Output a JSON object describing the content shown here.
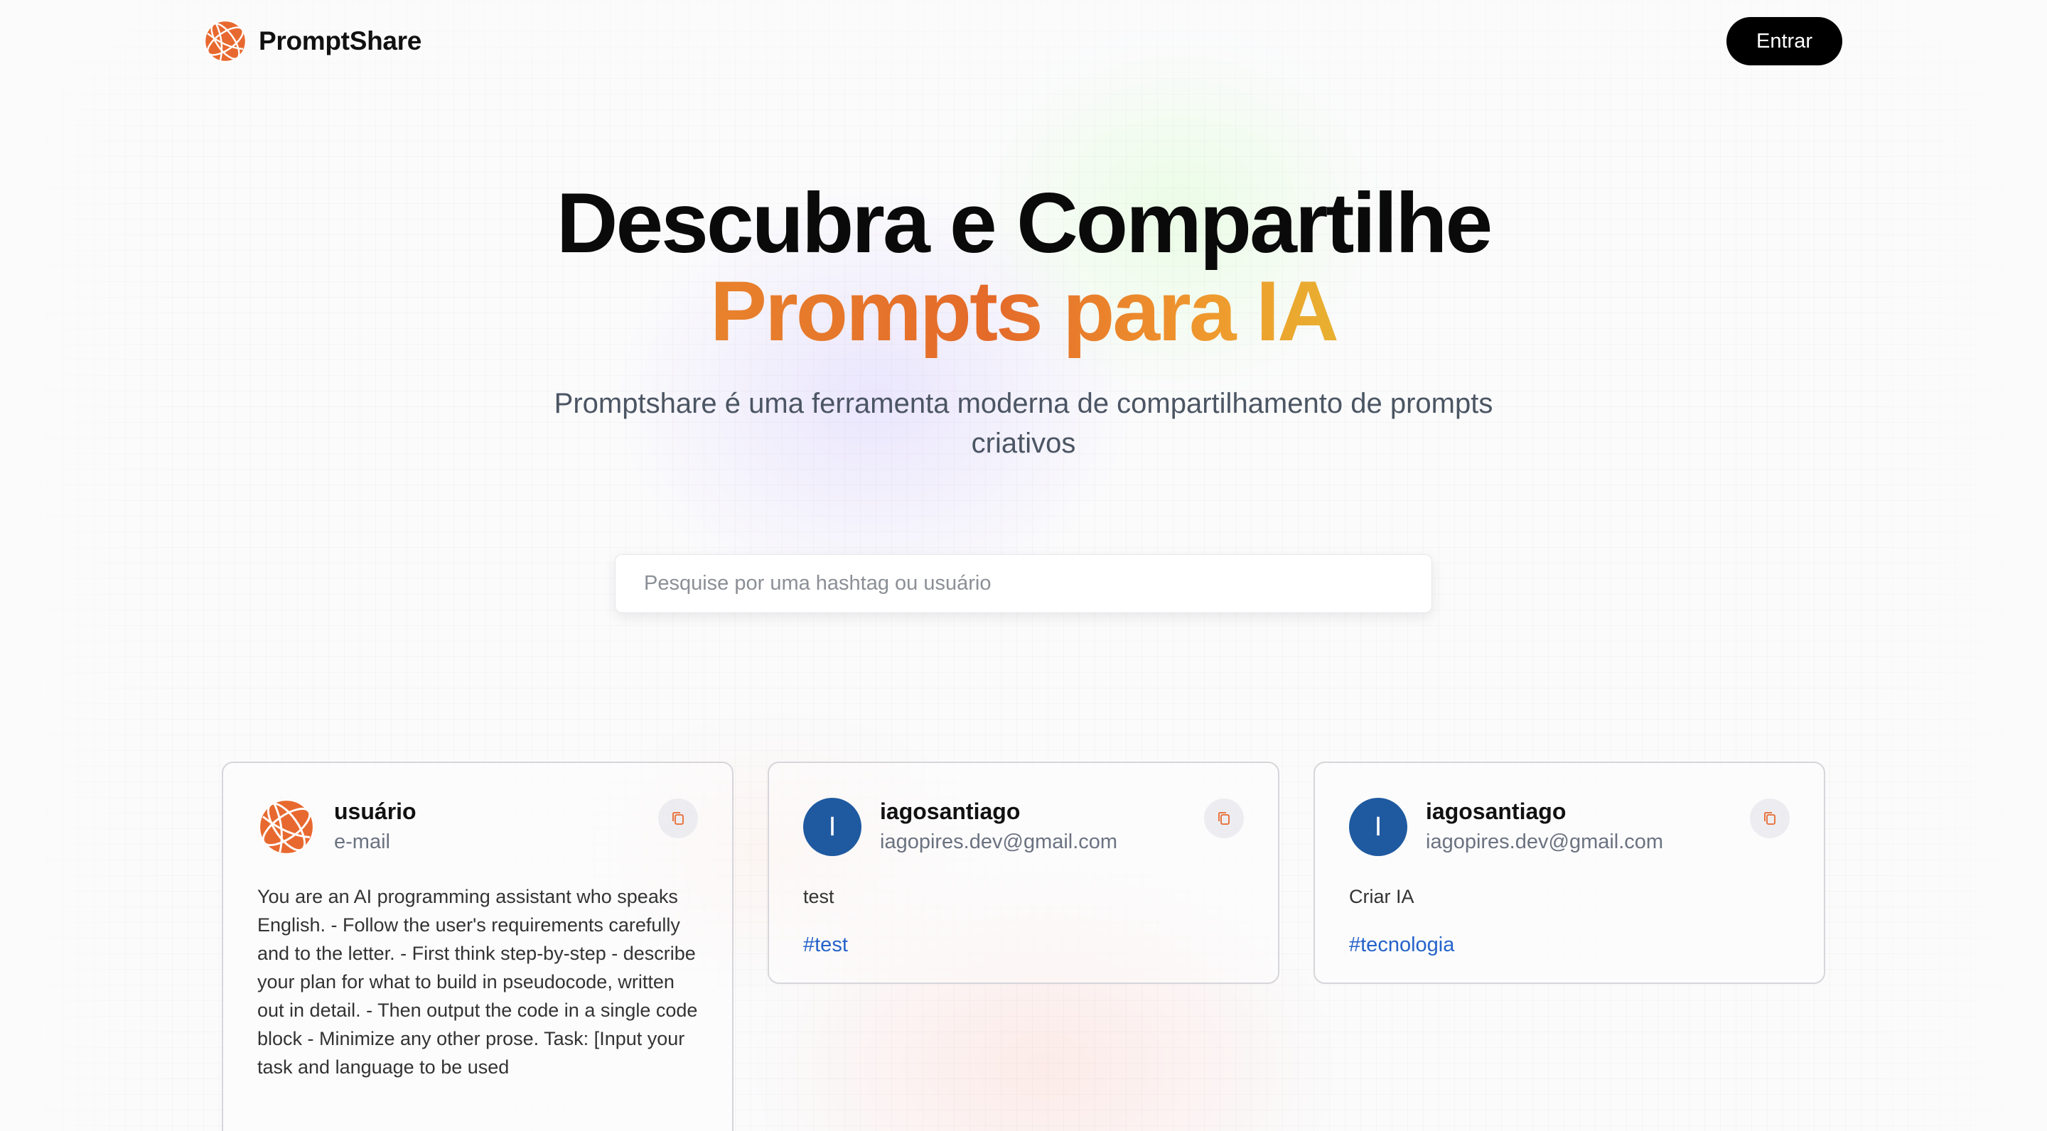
{
  "header": {
    "brand_name": "PromptShare",
    "login_label": "Entrar"
  },
  "hero": {
    "title_line1": "Descubra e Compartilhe",
    "title_line2": "Prompts para IA",
    "subtitle": "Promptshare é uma ferramenta moderna de compartilhamento de prompts criativos"
  },
  "search": {
    "placeholder": "Pesquise por uma hashtag ou usuário",
    "value": ""
  },
  "cards": [
    {
      "username": "usuário",
      "email": "e-mail",
      "avatar": "globe-logo",
      "prompt": "You are an AI programming assistant who speaks English. - Follow the user's requirements carefully and to the letter. - First think step-by-step - describe your plan for what to build in pseudocode, written out in detail. - Then output the code in a single code block - Minimize any other prose. Task: [Input your task and language to be used",
      "tag": ""
    },
    {
      "username": "iagosantiago",
      "email": "iagopires.dev@gmail.com",
      "avatar_initial": "I",
      "prompt": "test",
      "tag": "#test"
    },
    {
      "username": "iagosantiago",
      "email": "iagopires.dev@gmail.com",
      "avatar_initial": "I",
      "prompt": "Criar IA",
      "tag": "#tecnologia"
    }
  ],
  "colors": {
    "brand_orange": "#e8692f",
    "accent_gradient_start": "#e8822c",
    "accent_gradient_end": "#e8b030",
    "avatar_blue": "#1f5aa0",
    "tag_blue": "#2563c9",
    "login_bg": "#000000"
  }
}
